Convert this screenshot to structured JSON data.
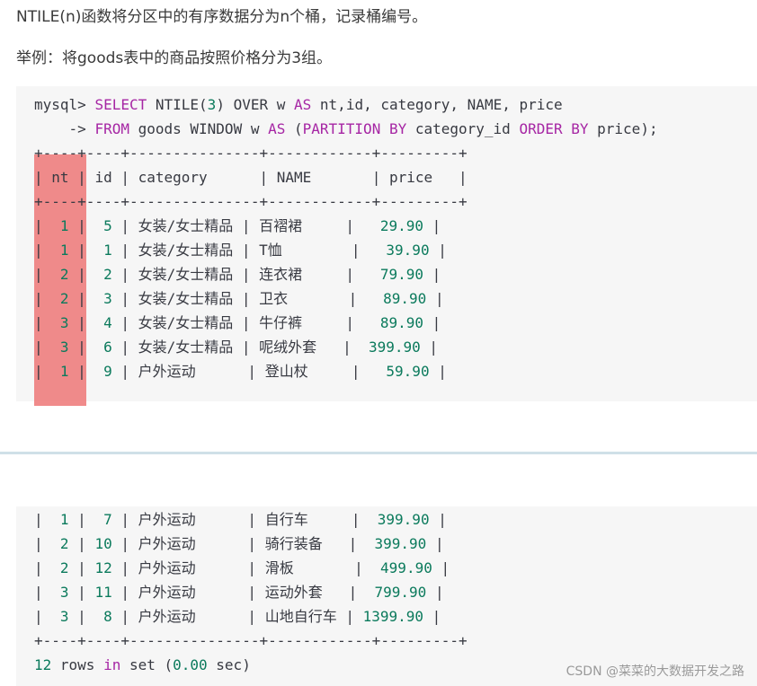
{
  "intro_line": "NTILE(n)函数将分区中的有序数据分为n个桶，记录桶编号。",
  "example_line": "举例：将goods表中的商品按照价格分为3组。",
  "query": {
    "prompt": "mysql> ",
    "select_kw": "SELECT",
    "select_rest_1": " NTILE(",
    "ntile_arg": "3",
    "select_rest_2": ") OVER w ",
    "as_kw": "AS",
    "select_rest_3": " nt,id, category, NAME, price",
    "cont_prompt": "    -> ",
    "from_kw": "FROM",
    "from_rest_1": " goods WINDOW w ",
    "as2_kw": "AS",
    "from_rest_2": " (",
    "partition_kw": "PARTITION BY",
    "from_rest_3": " category_id ",
    "order_kw": "ORDER BY",
    "from_rest_4": " price);"
  },
  "border_line": "+----+----+---------------+------------+---------+",
  "header": [
    "nt",
    "id",
    "category",
    "NAME",
    "price"
  ],
  "rows_top": [
    [
      "1",
      "5",
      "女装/女士精品",
      "百褶裙",
      "29.90"
    ],
    [
      "1",
      "1",
      "女装/女士精品",
      "T恤",
      "39.90"
    ],
    [
      "2",
      "2",
      "女装/女士精品",
      "连衣裙",
      "79.90"
    ],
    [
      "2",
      "3",
      "女装/女士精品",
      "卫衣",
      "89.90"
    ],
    [
      "3",
      "4",
      "女装/女士精品",
      "牛仔裤",
      "89.90"
    ],
    [
      "3",
      "6",
      "女装/女士精品",
      "呢绒外套",
      "399.90"
    ],
    [
      "1",
      "9",
      "户外运动",
      "登山杖",
      "59.90"
    ]
  ],
  "rows_bottom": [
    [
      "1",
      "7",
      "户外运动",
      "自行车",
      "399.90"
    ],
    [
      "2",
      "10",
      "户外运动",
      "骑行装备",
      "399.90"
    ],
    [
      "2",
      "12",
      "户外运动",
      "滑板",
      "499.90"
    ],
    [
      "3",
      "11",
      "户外运动",
      "运动外套",
      "799.90"
    ],
    [
      "3",
      "8",
      "户外运动",
      "山地自行车",
      "1399.90"
    ]
  ],
  "footer": {
    "count": "12",
    "text1": " rows ",
    "in_kw": "in",
    "text2": " set (",
    "time": "0.00",
    "text3": " sec)"
  },
  "watermark": "CSDN @菜菜的大数据开发之路"
}
